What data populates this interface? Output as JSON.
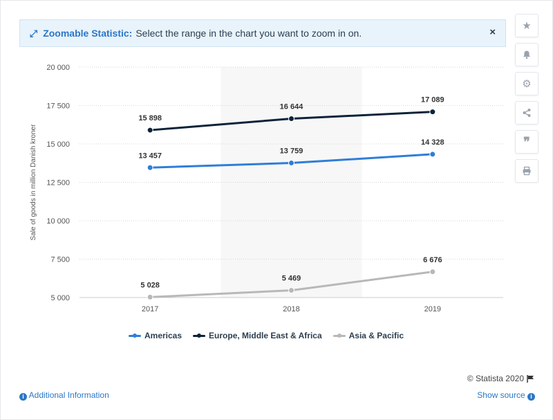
{
  "banner": {
    "title": "Zoomable Statistic:",
    "text": "Select the range in the chart you want to zoom in on.",
    "close_icon": "×"
  },
  "side_buttons": [
    "star-icon",
    "bell-icon",
    "gear-icon",
    "share-icon",
    "quote-icon",
    "print-icon"
  ],
  "footer": {
    "credit": "© Statista 2020",
    "additional_info": "Additional Information",
    "show_source": "Show source"
  },
  "chart_data": {
    "type": "line",
    "x": [
      "2017",
      "2018",
      "2019"
    ],
    "ylabel": "Sale of goods in million Danish kroner",
    "ylim": [
      5000,
      20000
    ],
    "yticks": [
      5000,
      7500,
      10000,
      12500,
      15000,
      17500,
      20000
    ],
    "ytick_labels": [
      "5 000",
      "7 500",
      "10 000",
      "12 500",
      "15 000",
      "17 500",
      "20 000"
    ],
    "grid": true,
    "legend_position": "bottom",
    "series": [
      {
        "name": "Americas",
        "color": "#2f7ed8",
        "values": [
          13457,
          13759,
          14328
        ],
        "labels": [
          "13 457",
          "13 759",
          "14 328"
        ]
      },
      {
        "name": "Europe, Middle East & Africa",
        "color": "#0d233a",
        "values": [
          15898,
          16644,
          17089
        ],
        "labels": [
          "15 898",
          "16 644",
          "17 089"
        ]
      },
      {
        "name": "Asia & Pacific",
        "color": "#b8b8b8",
        "values": [
          5028,
          5469,
          6676
        ],
        "labels": [
          "5 028",
          "5 469",
          "6 676"
        ]
      }
    ]
  }
}
